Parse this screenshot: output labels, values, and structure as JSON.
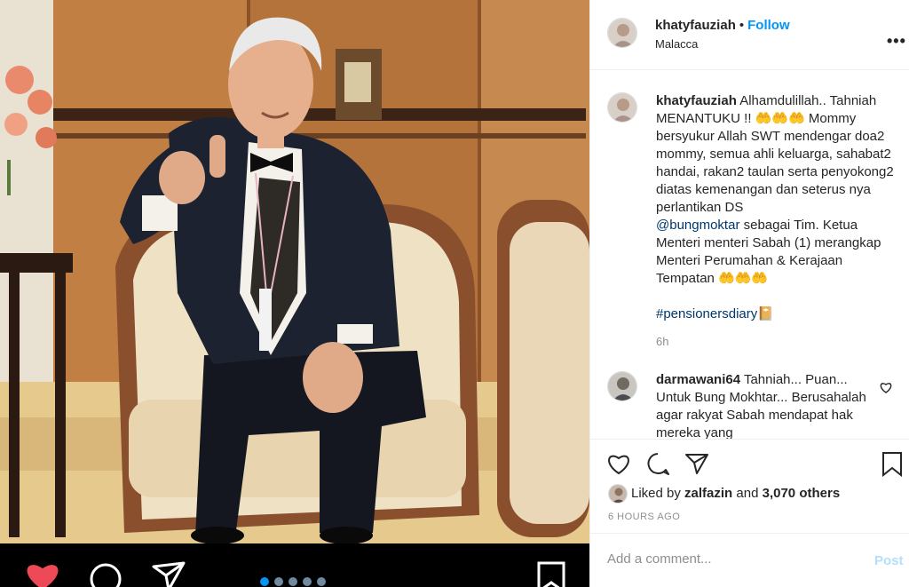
{
  "post": {
    "username": "khatyfauziah",
    "separator": "•",
    "follow_label": "Follow",
    "location": "Malacca",
    "more_label": "•••",
    "caption_user": "khatyfauziah",
    "caption_part1": "Alhamdulillah.. Tahniah MENANTUKU !! 🤲🤲🤲 Mommy bersyukur Allah SWT mendengar doa2 mommy, semua ahli keluarga, sahabat2 handai, rakan2 taulan serta penyokong2 diatas kemenangan dan seterus nya perlantikan DS",
    "mention": "@bungmoktar",
    "caption_part2": "sebagai Tim. Ketua Menteri menteri Sabah (1) merangkap Menteri Perumahan & Kerajaan Tempatan 🤲🤲🤲",
    "hashtag": "#pensionersdiary",
    "hashtag_emoji": "📔",
    "caption_time": "6h"
  },
  "comment": {
    "username": "darmawani64",
    "text": "Tahniah... Puan... Untuk Bung Mokhtar... Berusahalah agar rakyat Sabah mendapat hak mereka yang"
  },
  "likes": {
    "prefix": "Liked by",
    "user": "zalfazin",
    "joiner": "and",
    "count": "3,070 others"
  },
  "time_ago": "6 HOURS AGO",
  "add_comment": {
    "placeholder": "Add a comment...",
    "post_label": "Post"
  },
  "carousel": {
    "count": 5,
    "active_index": 0
  },
  "colors": {
    "accent": "#0095f6",
    "link": "#00376b",
    "muted": "#8e8e8e",
    "post_disabled": "#b2dffc",
    "like_red": "#ed4956"
  },
  "icons": [
    "heart-icon",
    "comment-icon",
    "share-icon",
    "bookmark-icon",
    "more-icon"
  ]
}
